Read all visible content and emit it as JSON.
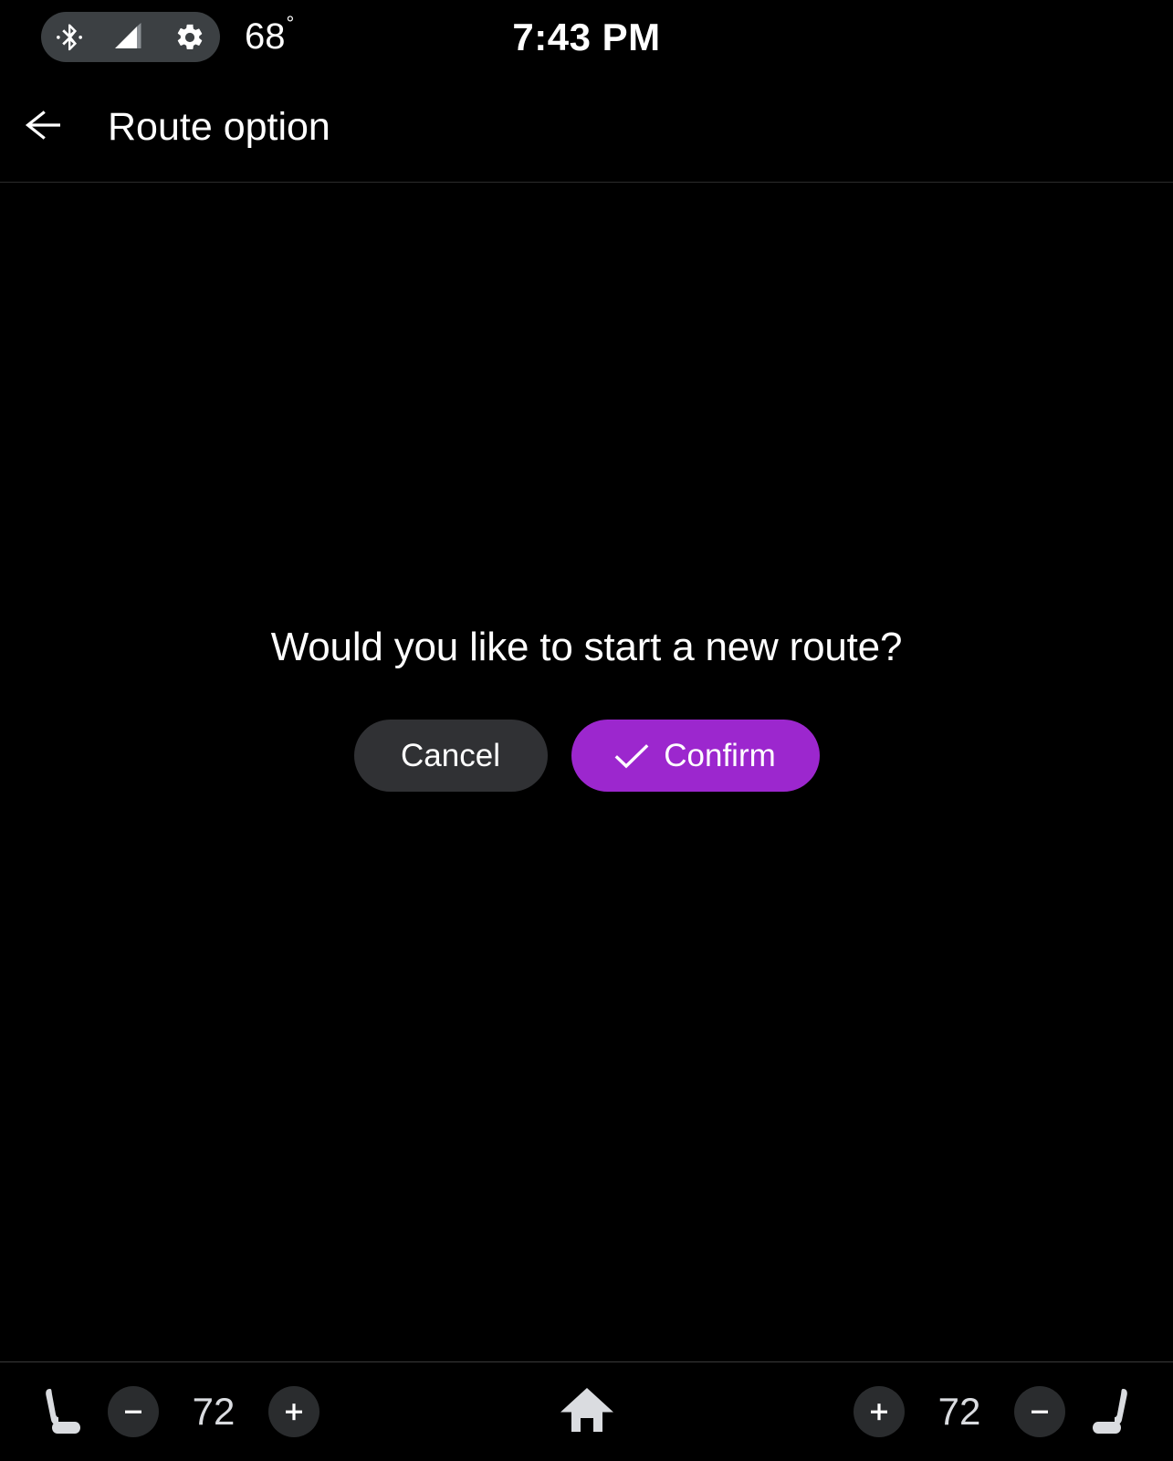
{
  "status_bar": {
    "icons": [
      {
        "name": "bluetooth-icon",
        "label": "bluetooth"
      },
      {
        "name": "signal-icon",
        "label": "cellular-signal"
      },
      {
        "name": "gear-icon",
        "label": "settings"
      }
    ],
    "temperature": "68",
    "degree_symbol": "°",
    "time": "7:43 PM",
    "pill_color": "#3C4043"
  },
  "header": {
    "back_icon": "arrow-left-icon",
    "title": "Route option"
  },
  "dialog": {
    "message": "Would you like to start a new route?",
    "cancel_label": "Cancel",
    "confirm_label": "Confirm",
    "confirm_icon": "check-icon",
    "confirm_color": "#9C27CE",
    "cancel_color": "#303134"
  },
  "bottom_bar": {
    "home_icon": "home-icon",
    "left_climate": {
      "seat_icon": "car-seat-icon",
      "decrease_label": "−",
      "temperature": "72",
      "increase_label": "+"
    },
    "right_climate": {
      "increase_label": "+",
      "temperature": "72",
      "decrease_label": "−",
      "seat_icon": "car-seat-icon"
    }
  }
}
